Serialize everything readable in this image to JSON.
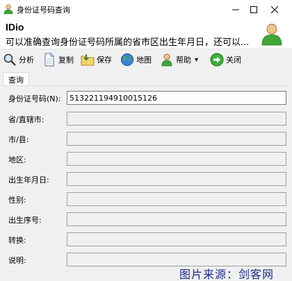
{
  "window": {
    "title": "身份证号码查询",
    "icon": "person-icon",
    "controls": [
      "minimize-icon",
      "maximize-icon",
      "close-icon"
    ]
  },
  "header": {
    "app_name": "IDio",
    "description": "可以准确查询身份证号码所属的省市区出生年月日，还可以..."
  },
  "toolbar": {
    "items": [
      {
        "label": "分析",
        "icon": "magnifier-icon"
      },
      {
        "label": "复制",
        "icon": "document-icon"
      },
      {
        "label": "保存",
        "icon": "save-folder-icon"
      },
      {
        "label": "地图",
        "icon": "globe-icon"
      },
      {
        "label": "帮助",
        "icon": "person-help-icon",
        "dropdown": "▾"
      },
      {
        "label": "关闭",
        "icon": "green-arrow-icon"
      }
    ]
  },
  "tabs": [
    {
      "label": "查询"
    }
  ],
  "form": {
    "fields": [
      {
        "label": "身份证号码(N):",
        "value": "513221194910015126"
      },
      {
        "label": "省/直辖市:",
        "value": ""
      },
      {
        "label": "市/县:",
        "value": ""
      },
      {
        "label": "地区:",
        "value": ""
      },
      {
        "label": "出生年月日:",
        "value": ""
      },
      {
        "label": "性别:",
        "value": ""
      },
      {
        "label": "出生序号:",
        "value": ""
      },
      {
        "label": "转换:",
        "value": ""
      },
      {
        "label": "说明:",
        "value": ""
      }
    ]
  },
  "watermark": "图片来源：剑客网",
  "colors": {
    "toolbar_bg": "#f0f0f0",
    "watermark": "#1b2a8c",
    "avatar_green": "#3fa535"
  }
}
